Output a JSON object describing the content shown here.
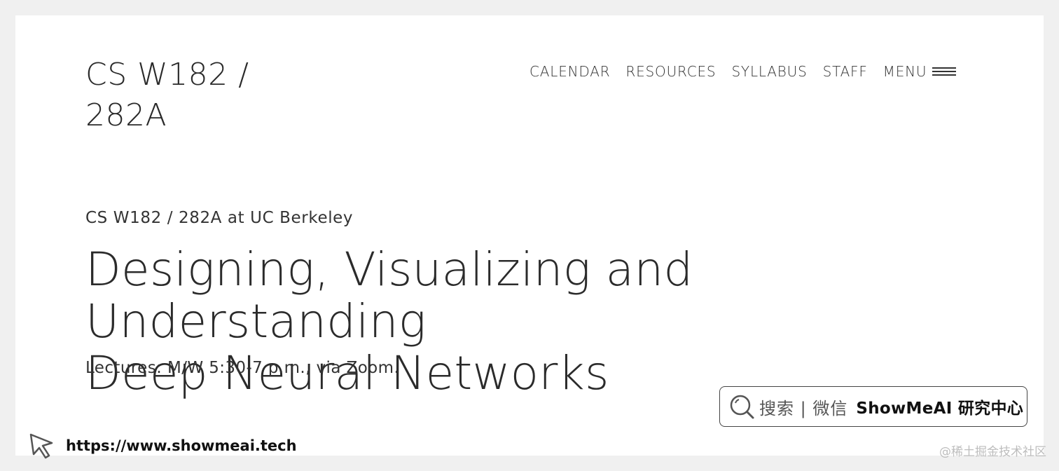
{
  "header": {
    "site_title_line1": "CS W182 /",
    "site_title_line2": "282A",
    "nav": [
      "CALENDAR",
      "RESOURCES",
      "SYLLABUS",
      "STAFF"
    ],
    "menu_label": "MENU"
  },
  "hero": {
    "kicker": "CS W182 / 282A at UC Berkeley",
    "headline_line1": "Designing, Visualizing and Understanding",
    "headline_line2": "Deep Neural Networks",
    "lectures": "Lectures: M/W 5:30-7 p.m., via Zoom."
  },
  "overlay": {
    "search_label": "搜索 | 微信",
    "search_brand": "ShowMeAI 研究中心",
    "footer_url": "https://www.showmeai.tech",
    "watermark": "@稀土掘金技术社区"
  },
  "icons": {
    "menu": "hamburger-icon",
    "search": "magnifier-icon",
    "cursor": "cursor-arrow-icon"
  },
  "colors": {
    "background": "#f0f0f0",
    "page": "#ffffff",
    "text": "#2b2b2b",
    "watermark": "#bdbdbd"
  }
}
